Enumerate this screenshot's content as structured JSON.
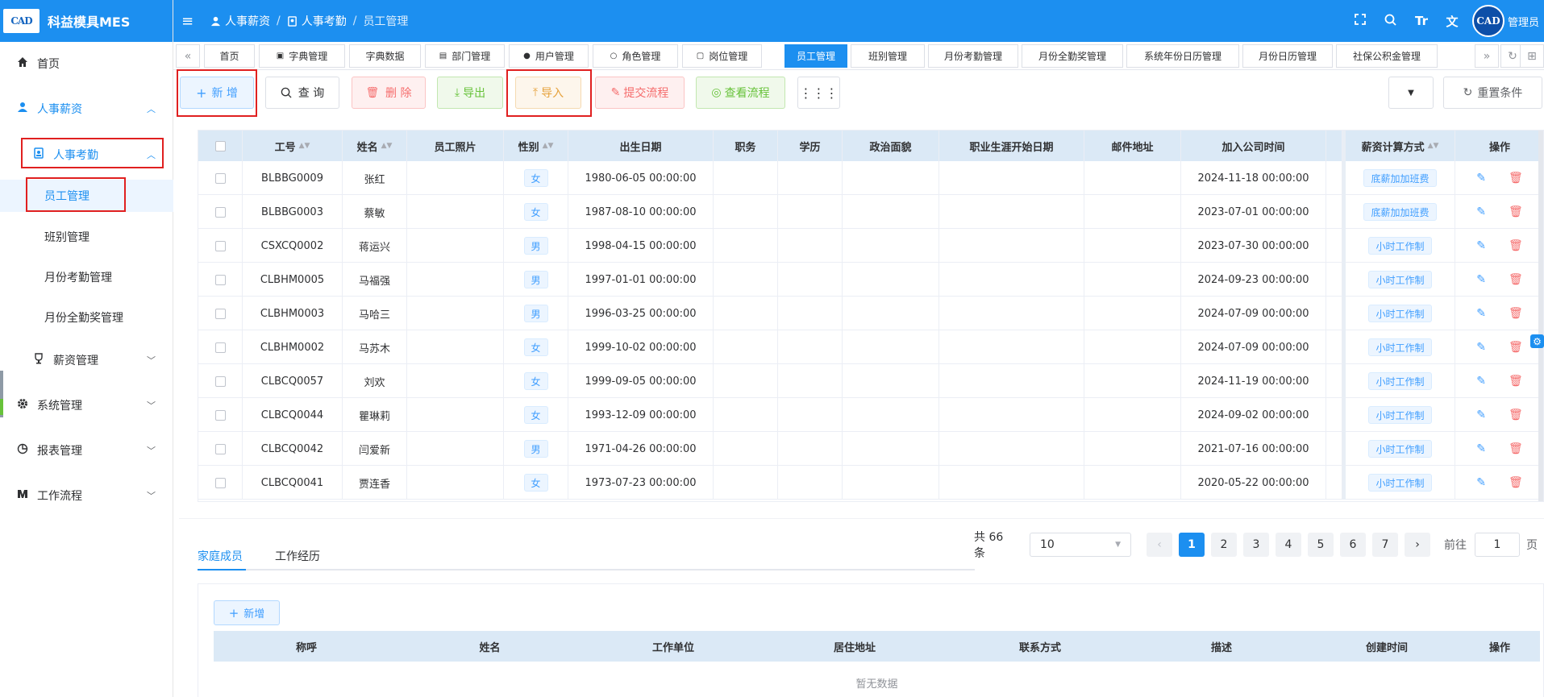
{
  "app": {
    "logo_text": "CAD",
    "title": "科益模具MES"
  },
  "sidebar": {
    "items": [
      {
        "label": "首页"
      },
      {
        "label": "人事薪资"
      },
      {
        "label": "人事考勤"
      },
      {
        "label": "员工管理"
      },
      {
        "label": "班别管理"
      },
      {
        "label": "月份考勤管理"
      },
      {
        "label": "月份全勤奖管理"
      },
      {
        "label": "薪资管理"
      },
      {
        "label": "系统管理"
      },
      {
        "label": "报表管理"
      },
      {
        "label": "工作流程"
      }
    ]
  },
  "header": {
    "breadcrumb": [
      "人事薪资",
      "人事考勤",
      "员工管理"
    ],
    "avatar_text": "CAD",
    "user": "管理员"
  },
  "tabs": [
    "首页",
    "字典管理",
    "字典数据",
    "部门管理",
    "用户管理",
    "角色管理",
    "岗位管理",
    "员工管理",
    "班别管理",
    "月份考勤管理",
    "月份全勤奖管理",
    "系统年份日历管理",
    "月份日历管理",
    "社保公积金管理"
  ],
  "toolbar": {
    "add": "新 增",
    "query": "查 询",
    "delete": "删 除",
    "export": "导出",
    "import": "导入",
    "submit_flow": "提交流程",
    "view_flow": "查看流程",
    "reset": "重置条件"
  },
  "table": {
    "columns": [
      "工号",
      "姓名",
      "员工照片",
      "性别",
      "出生日期",
      "职务",
      "学历",
      "政治面貌",
      "职业生涯开始日期",
      "邮件地址",
      "加入公司时间",
      "薪资计算方式",
      "操作"
    ],
    "rows": [
      [
        "BLBBG0009",
        "张红",
        "女",
        "1980-06-05 00:00:00",
        "2024-11-18 00:00:00",
        "底薪加加班费"
      ],
      [
        "BLBBG0003",
        "蔡敏",
        "女",
        "1987-08-10 00:00:00",
        "2023-07-01 00:00:00",
        "底薪加加班费"
      ],
      [
        "CSXCQ0002",
        "蒋运兴",
        "男",
        "1998-04-15 00:00:00",
        "2023-07-30 00:00:00",
        "小时工作制"
      ],
      [
        "CLBHM0005",
        "马福强",
        "男",
        "1997-01-01 00:00:00",
        "2024-09-23 00:00:00",
        "小时工作制"
      ],
      [
        "CLBHM0003",
        "马哈三",
        "男",
        "1996-03-25 00:00:00",
        "2024-07-09 00:00:00",
        "小时工作制"
      ],
      [
        "CLBHM0002",
        "马苏木",
        "女",
        "1999-10-02 00:00:00",
        "2024-07-09 00:00:00",
        "小时工作制"
      ],
      [
        "CLBCQ0057",
        "刘欢",
        "女",
        "1999-09-05 00:00:00",
        "2024-11-19 00:00:00",
        "小时工作制"
      ],
      [
        "CLBCQ0044",
        "瞿琳莉",
        "女",
        "1993-12-09 00:00:00",
        "2024-09-02 00:00:00",
        "小时工作制"
      ],
      [
        "CLBCQ0042",
        "闫爱新",
        "男",
        "1971-04-26 00:00:00",
        "2021-07-16 00:00:00",
        "小时工作制"
      ],
      [
        "CLBCQ0041",
        "贾连香",
        "女",
        "1973-07-23 00:00:00",
        "2020-05-22 00:00:00",
        "小时工作制"
      ]
    ]
  },
  "pagination": {
    "total": "共 66 条",
    "page_size": "10",
    "pages": [
      "1",
      "2",
      "3",
      "4",
      "5",
      "6",
      "7"
    ],
    "goto_label": "前往",
    "goto_value": "1",
    "page_unit": "页"
  },
  "bottom": {
    "tabs": [
      "家庭成员",
      "工作经历"
    ],
    "add": "新增",
    "columns": [
      "称呼",
      "姓名",
      "工作单位",
      "居住地址",
      "联系方式",
      "描述",
      "创建时间",
      "操作"
    ],
    "empty": "暂无数据"
  },
  "colors": {
    "primary": "#1c8ff0",
    "header_row": "#dbe9f6",
    "danger": "#f56c6c",
    "success": "#67c23a",
    "warning": "#e6a23c"
  }
}
